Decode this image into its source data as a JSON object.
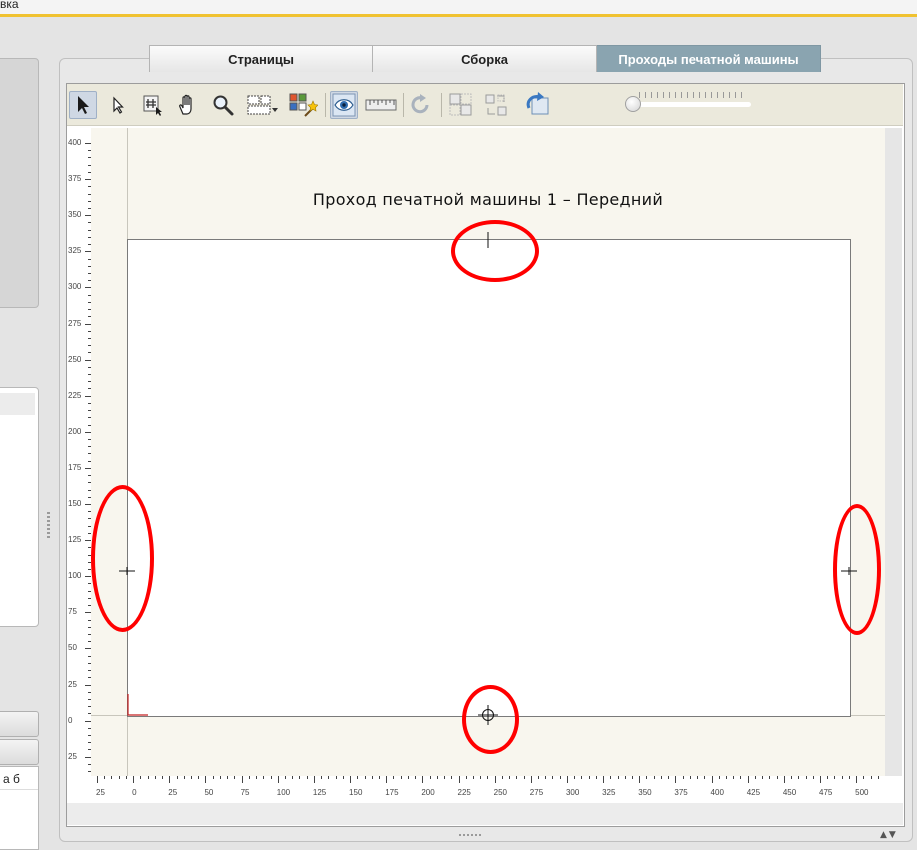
{
  "window": {
    "top_label": "вка"
  },
  "left_panel": {
    "cell_text": "а б"
  },
  "tabs": [
    {
      "label": "Страницы",
      "active": false
    },
    {
      "label": "Сборка",
      "active": false
    },
    {
      "label": "Проходы печатной машины",
      "active": true
    }
  ],
  "toolbar": {
    "tools": [
      {
        "name": "select-arrow-icon",
        "selected": true
      },
      {
        "name": "subselect-arrow-icon",
        "selected": false
      },
      {
        "name": "grid-select-icon",
        "selected": false
      },
      {
        "name": "hand-pan-icon",
        "selected": false
      },
      {
        "name": "zoom-icon",
        "selected": false
      },
      {
        "name": "marquee-dropdown-icon",
        "selected": false
      },
      {
        "name": "auto-arrange-icon",
        "selected": false
      },
      {
        "name": "preview-eye-icon",
        "selected": true
      },
      {
        "name": "ruler-measure-icon",
        "selected": false
      },
      {
        "name": "rotate-icon",
        "selected": false
      },
      {
        "name": "tile-icon",
        "selected": false
      },
      {
        "name": "swap-icon",
        "selected": false
      },
      {
        "name": "reset-view-icon",
        "selected": false
      }
    ],
    "zoom_level": 0
  },
  "canvas": {
    "title": "Проход печатной машины 1 – Передний",
    "vertical_ruler": [
      "400",
      "375",
      "350",
      "325",
      "300",
      "275",
      "250",
      "225",
      "200",
      "175",
      "150",
      "125",
      "100",
      "75",
      "50",
      "25",
      "0",
      "25"
    ],
    "horizontal_ruler": [
      "25",
      "0",
      "25",
      "50",
      "75",
      "100",
      "125",
      "150",
      "175",
      "200",
      "225",
      "250",
      "275",
      "300",
      "325",
      "350",
      "375",
      "400",
      "425",
      "450",
      "475",
      "500"
    ]
  },
  "colors": {
    "accent_bar": "#f0c230",
    "active_tab": "#8aa4b0",
    "callout": "#ff0000"
  }
}
